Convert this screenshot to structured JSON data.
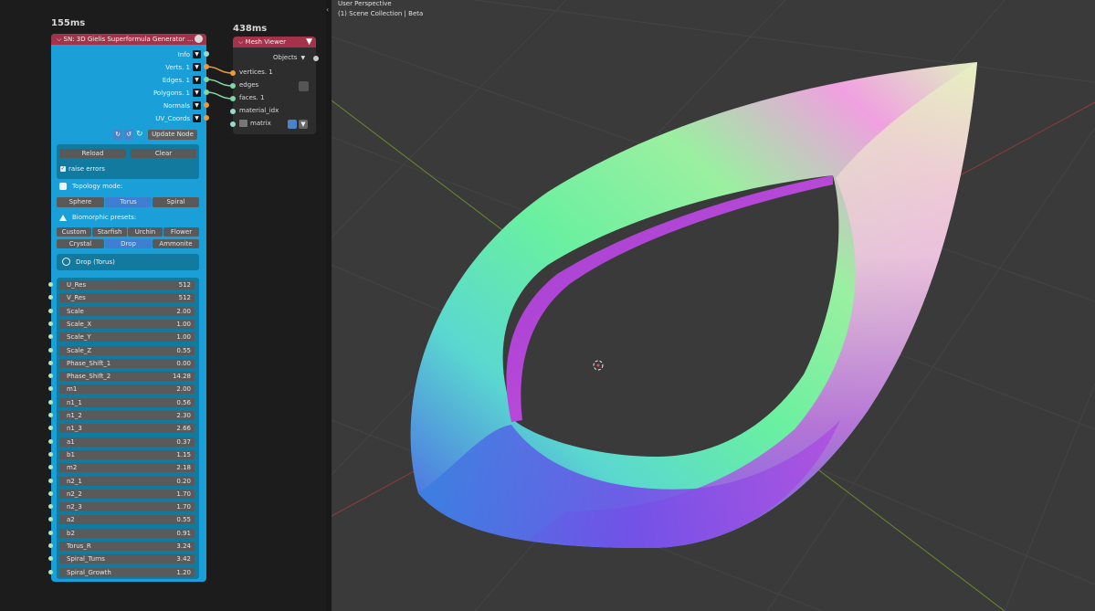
{
  "editor": {
    "sn_timing": "155ms",
    "mv_timing": "438ms"
  },
  "sn_node": {
    "title": "SN: 3D Gielis Superformula Generator ...",
    "outputs": [
      {
        "label": "Info"
      },
      {
        "label": "Verts. 1"
      },
      {
        "label": "Edges. 1"
      },
      {
        "label": "Polygons. 1"
      },
      {
        "label": "Normals"
      },
      {
        "label": "UV_Coords"
      }
    ],
    "update_label": "Update Node",
    "reload_label": "Reload",
    "clear_label": "Clear",
    "raise_errors_label": "raise errors",
    "topology_label": "Topology mode:",
    "topology_modes": [
      "Sphere",
      "Torus",
      "Spiral"
    ],
    "topology_selected": "Torus",
    "presets_label": "Biomorphic presets:",
    "presets_row1": [
      "Custom",
      "Starfish",
      "Urchin",
      "Flower"
    ],
    "presets_row2": [
      "Crystal",
      "Drop",
      "Ammonite"
    ],
    "preset_selected": "Drop",
    "current_preset": "Drop (Torus)",
    "params": [
      {
        "name": "U_Res",
        "value": "512"
      },
      {
        "name": "V_Res",
        "value": "512"
      },
      {
        "name": "Scale",
        "value": "2.00"
      },
      {
        "name": "Scale_X",
        "value": "1.00"
      },
      {
        "name": "Scale_Y",
        "value": "1.00"
      },
      {
        "name": "Scale_Z",
        "value": "0.55"
      },
      {
        "name": "Phase_Shift_1",
        "value": "0.00"
      },
      {
        "name": "Phase_Shift_2",
        "value": "14.28"
      },
      {
        "name": "m1",
        "value": "2.00"
      },
      {
        "name": "n1_1",
        "value": "0.56"
      },
      {
        "name": "n1_2",
        "value": "2.30"
      },
      {
        "name": "n1_3",
        "value": "2.66"
      },
      {
        "name": "a1",
        "value": "0.37"
      },
      {
        "name": "b1",
        "value": "1.15"
      },
      {
        "name": "m2",
        "value": "2.18"
      },
      {
        "name": "n2_1",
        "value": "0.20"
      },
      {
        "name": "n2_2",
        "value": "1.70"
      },
      {
        "name": "n2_3",
        "value": "1.70"
      },
      {
        "name": "a2",
        "value": "0.55"
      },
      {
        "name": "b2",
        "value": "0.91"
      },
      {
        "name": "Torus_R",
        "value": "3.24"
      },
      {
        "name": "Spiral_Turns",
        "value": "3.42"
      },
      {
        "name": "Spiral_Growth",
        "value": "1.20"
      }
    ]
  },
  "mv_node": {
    "title": "Mesh Viewer",
    "objects_label": "Objects",
    "inputs": [
      {
        "label": "vertices. 1"
      },
      {
        "label": "edges"
      },
      {
        "label": "faces. 1"
      },
      {
        "label": "material_idx"
      },
      {
        "label": "matrix"
      }
    ]
  },
  "viewport": {
    "mode": "User Perspective",
    "collection": "(1) Scene Collection | Beta"
  },
  "colors": {
    "node_body": "#1a9fd8",
    "node_header": "#a3324a",
    "link_orange": "#e89a3c",
    "link_green": "#7fd7a6",
    "selected_blue": "#3f7ed0"
  }
}
